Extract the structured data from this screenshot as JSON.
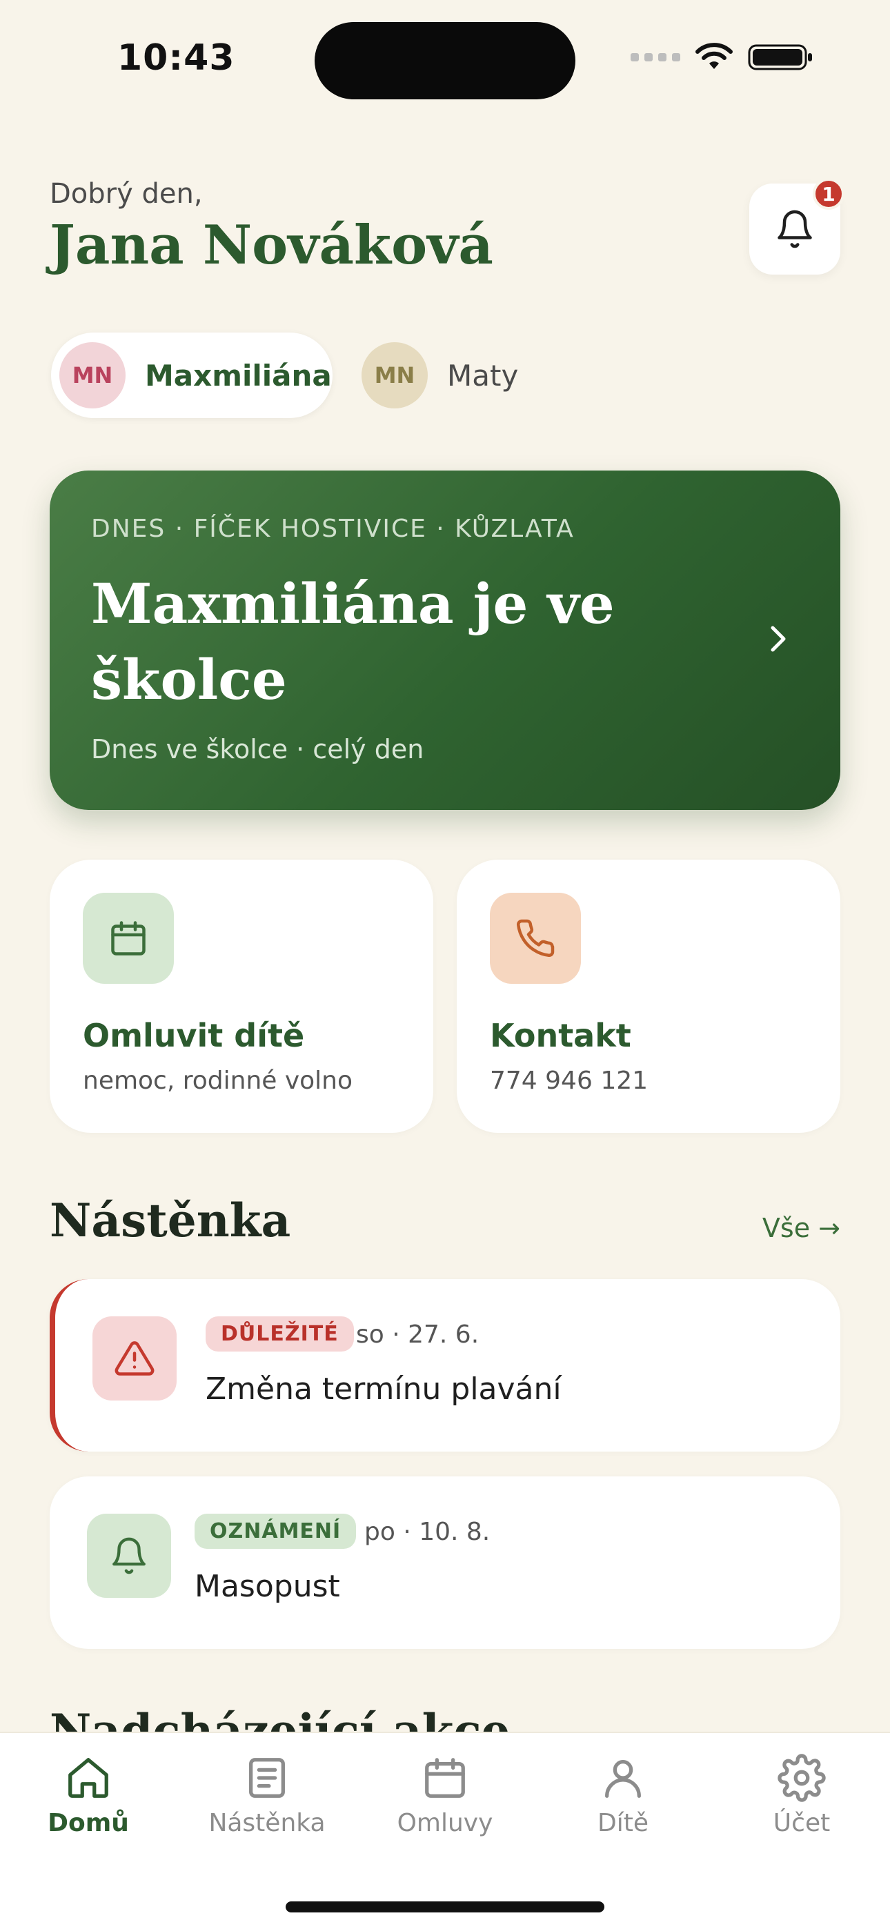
{
  "status_bar": {
    "time": "10:43"
  },
  "header": {
    "greeting": "Dobrý den,",
    "name": "Jana Nováková",
    "notification_count": "1"
  },
  "children": [
    {
      "initials": "MN",
      "name": "Maxmiliána",
      "active": true
    },
    {
      "initials": "MN",
      "name": "Maty",
      "active": false
    }
  ],
  "hero": {
    "eyebrow": "DNES · FÍČEK HOSTIVICE · KŮZLATA",
    "title": "Maxmiliána je ve školce",
    "subtitle": "Dnes ve školce · celý den"
  },
  "quick_actions": [
    {
      "title": "Omluvit dítě",
      "subtitle": "nemoc, rodinné volno",
      "icon": "calendar-icon"
    },
    {
      "title": "Kontakt",
      "subtitle": "774 946 121",
      "icon": "phone-icon"
    }
  ],
  "board": {
    "title": "Nástěnka",
    "see_all": "Vše →",
    "items": [
      {
        "tag": "DŮLEŽITÉ",
        "date": "so · 27. 6.",
        "title": "Změna termínu plavání",
        "icon": "warning-icon"
      },
      {
        "tag": "OZNÁMENÍ",
        "date": "po · 10. 8.",
        "title": "Masopust",
        "icon": "bell-icon"
      }
    ]
  },
  "next_section": {
    "title": "Nadcházející akce"
  },
  "tabbar": [
    {
      "label": "Domů",
      "icon": "home-icon",
      "active": true
    },
    {
      "label": "Nástěnka",
      "icon": "board-icon",
      "active": false
    },
    {
      "label": "Omluvy",
      "icon": "calendar-icon",
      "active": false
    },
    {
      "label": "Dítě",
      "icon": "person-icon",
      "active": false
    },
    {
      "label": "Účet",
      "icon": "gear-icon",
      "active": false
    }
  ],
  "colors": {
    "background": "#F8F4EA",
    "primary_green": "#2C5A2E",
    "alert_red": "#C5392E"
  }
}
